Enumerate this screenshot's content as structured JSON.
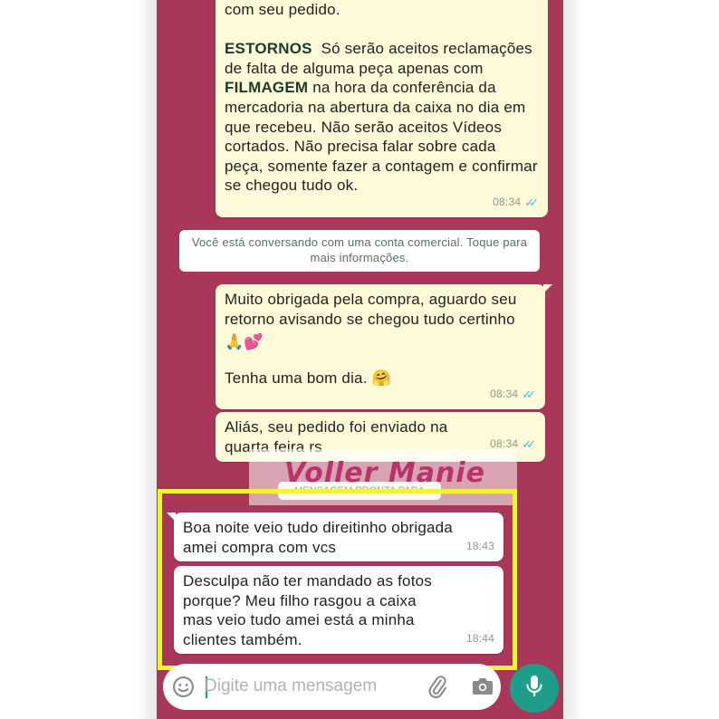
{
  "chat": {
    "msg1": {
      "lines": [
        "com seu pedido."
      ],
      "section_heading": "ESTORNOS",
      "section_text_a": "Só serão aceitos reclamações de falta de alguma peça apenas com",
      "section_emphasis": "FILMAGEM",
      "section_text_b": "na hora da conferência da mercadoria na abertura da caixa no dia em que recebeu. Não serão aceitos Vídeos cortados. Não precisa falar sobre cada peça, somente fazer a contagem e confirmar se chegou tudo ok.",
      "time": "08:34"
    },
    "system_notice": "Você está conversando com uma conta comercial. Toque para mais informações.",
    "msg2": {
      "text_a": "Muito obrigada pela compra, aguardo seu retorno avisando se chegou tudo certinho",
      "emojis_a": "🙏💕",
      "text_b": "Tenha uma bom dia. 🤗",
      "time": "08:34"
    },
    "msg3": {
      "text": "Aliás, seu pedido foi enviado na quarta feira rs",
      "time": "08:34"
    },
    "date_divider": "MENSAGEM PRONTA PARA",
    "watermark": "Voller Manie",
    "incoming1": {
      "text": "Boa noite veio tudo direitinho obrigada amei compra com vcs",
      "time": "18:43"
    },
    "incoming2": {
      "text": "Desculpa não ter mandado as fotos porque? Meu filho rasgou a caixa mas veio tudo amei está a minha clientes também.",
      "time": "18:44"
    }
  },
  "composer": {
    "placeholder": "Digite uma mensagem"
  },
  "colors": {
    "wallpaper": "#a8375a",
    "outgoing_bubble": "#fcfad9",
    "incoming_bubble": "#ffffff",
    "highlight_border": "#f4f13c",
    "mic_button": "#1e9e8a",
    "read_ticks": "#4fb6ec"
  },
  "icons": [
    "double-check-icon",
    "emoji-icon",
    "paperclip-icon",
    "camera-icon",
    "microphone-icon"
  ]
}
